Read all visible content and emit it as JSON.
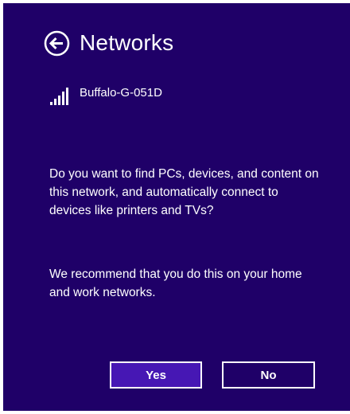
{
  "colors": {
    "panel_background": "#1f0068",
    "accent_button": "#4617b4",
    "text": "#ffffff"
  },
  "header": {
    "back_icon": "back-arrow-circle-icon",
    "title": "Networks"
  },
  "network": {
    "signal_icon": "wifi-signal-icon",
    "signal_strength_bars": 5,
    "name": "Buffalo-G-051D"
  },
  "prompt": {
    "question": "Do you want to find PCs, devices, and content on this network, and automatically connect to devices like printers and TVs?",
    "recommendation": "We recommend that you do this on your home and work networks."
  },
  "buttons": {
    "yes_label": "Yes",
    "no_label": "No"
  }
}
